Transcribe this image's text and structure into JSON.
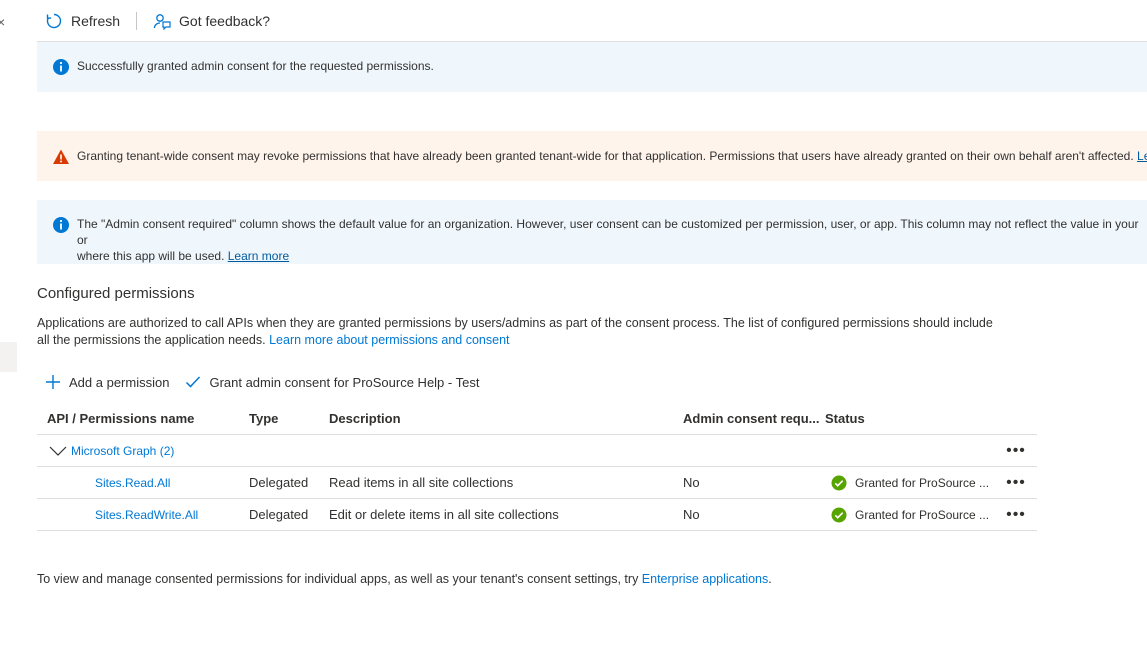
{
  "toolbar": {
    "refresh_label": "Refresh",
    "feedback_label": "Got feedback?"
  },
  "banners": {
    "success": "Successfully granted admin consent for the requested permissions.",
    "warning_text": "Granting tenant-wide consent may revoke permissions that have already been granted tenant-wide for that application. Permissions that users have already granted on their own behalf aren't affected. ",
    "warning_link": "Le",
    "info_text": "The \"Admin consent required\" column shows the default value for an organization. However, user consent can be customized per permission, user, or app. This column may not reflect the value in your or",
    "info_text2": "where this app will be used. ",
    "info_link": "Learn more"
  },
  "section": {
    "title": "Configured permissions",
    "desc_line1": "Applications are authorized to call APIs when they are granted permissions by users/admins as part of the consent process. The list of configured permissions should include",
    "desc_line2": "all the permissions the application needs. ",
    "desc_link": "Learn more about permissions and consent"
  },
  "actions": {
    "add_permission": "Add a permission",
    "grant_consent": "Grant admin consent for ProSource Help - Test"
  },
  "table": {
    "headers": {
      "api": "API / Permissions name",
      "type": "Type",
      "description": "Description",
      "admin": "Admin consent requ...",
      "status": "Status"
    },
    "group": {
      "label": "Microsoft Graph (2)"
    },
    "rows": [
      {
        "name": "Sites.Read.All",
        "type": "Delegated",
        "description": "Read items in all site collections",
        "admin": "No",
        "status": "Granted for ProSource ..."
      },
      {
        "name": "Sites.ReadWrite.All",
        "type": "Delegated",
        "description": "Edit or delete items in all site collections",
        "admin": "No",
        "status": "Granted for ProSource ..."
      }
    ],
    "more_glyph": "•••"
  },
  "footer": {
    "text": "To view and manage consented permissions for individual apps, as well as your tenant's consent settings, try ",
    "link": "Enterprise applications",
    "end": "."
  },
  "colors": {
    "accent": "#0078d4",
    "info_bg": "#eff6fc",
    "warning_bg": "#fff4ec",
    "warning_icon": "#d83b01",
    "success": "#57a300"
  }
}
